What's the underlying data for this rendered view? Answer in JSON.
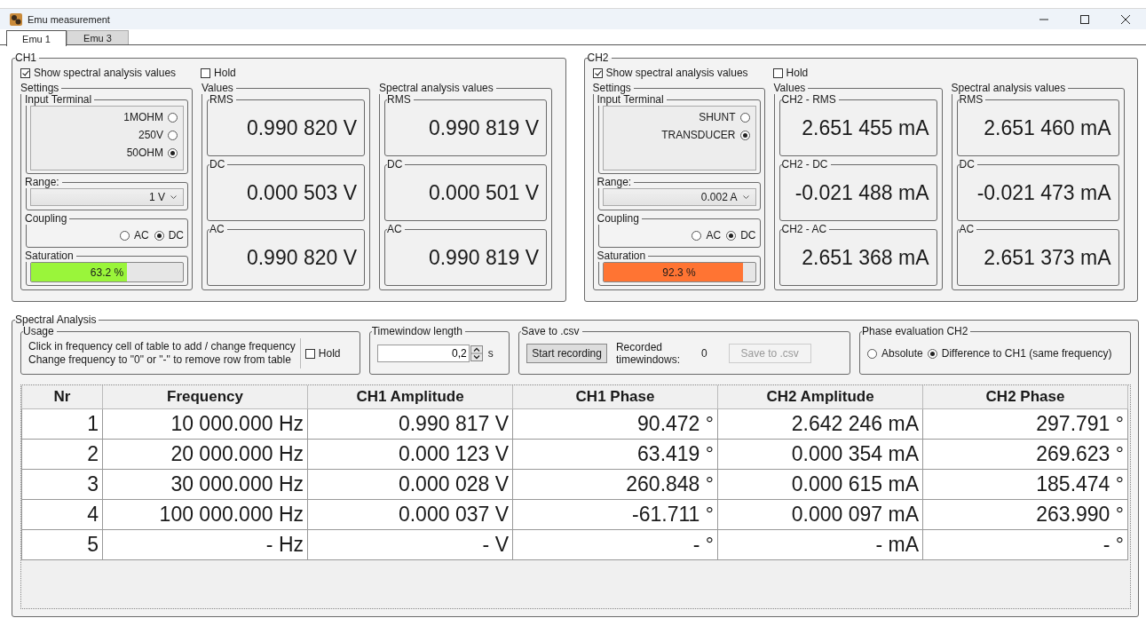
{
  "window": {
    "title": "Emu measurement"
  },
  "tabs": [
    {
      "label": "Emu 1",
      "selected": true
    },
    {
      "label": "Emu 3",
      "selected": false
    }
  ],
  "channels": [
    {
      "title": "CH1",
      "show_spectral": {
        "label": "Show spectral analysis values",
        "checked": true
      },
      "hold": {
        "label": "Hold",
        "checked": false
      },
      "settings": {
        "title": "Settings",
        "input_terminal": {
          "title": "Input Terminal",
          "options": [
            {
              "label": "1MOHM",
              "selected": false
            },
            {
              "label": "250V",
              "selected": false
            },
            {
              "label": "50OHM",
              "selected": true
            }
          ]
        },
        "range": {
          "title": "Range:",
          "value": "1 V"
        },
        "coupling": {
          "title": "Coupling",
          "options": [
            {
              "label": "AC",
              "selected": false
            },
            {
              "label": "DC",
              "selected": true
            }
          ]
        },
        "saturation": {
          "title": "Saturation",
          "level": 0.632,
          "reading": "63.2 %",
          "color": "#9af53a"
        }
      },
      "values": {
        "title": "Values",
        "items": [
          {
            "label": "RMS",
            "value": "0.990 820 V"
          },
          {
            "label": "DC",
            "value": "0.000 503 V"
          },
          {
            "label": "AC",
            "value": "0.990 820 V"
          }
        ]
      },
      "spectral": {
        "title": "Spectral analysis values",
        "items": [
          {
            "label": "RMS",
            "value": "0.990 819 V"
          },
          {
            "label": "DC",
            "value": "0.000 501 V"
          },
          {
            "label": "AC",
            "value": "0.990 819 V"
          }
        ]
      }
    },
    {
      "title": "CH2",
      "show_spectral": {
        "label": "Show spectral analysis values",
        "checked": true
      },
      "hold": {
        "label": "Hold",
        "checked": false
      },
      "settings": {
        "title": "Settings",
        "input_terminal": {
          "title": "Input Terminal",
          "options": [
            {
              "label": "SHUNT",
              "selected": false
            },
            {
              "label": "TRANSDUCER",
              "selected": true
            }
          ]
        },
        "range": {
          "title": "Range:",
          "value": "0.002 A"
        },
        "coupling": {
          "title": "Coupling",
          "options": [
            {
              "label": "AC",
              "selected": false
            },
            {
              "label": "DC",
              "selected": true
            }
          ]
        },
        "saturation": {
          "title": "Saturation",
          "level": 0.923,
          "reading": "92.3 %",
          "color": "#ff7433"
        }
      },
      "values": {
        "title": "Values",
        "items": [
          {
            "label": "CH2 - RMS",
            "value": "2.651 455 mA"
          },
          {
            "label": "CH2 - DC",
            "value": "-0.021 488 mA"
          },
          {
            "label": "CH2 - AC",
            "value": "2.651 368 mA"
          }
        ]
      },
      "spectral": {
        "title": "Spectral analysis values",
        "items": [
          {
            "label": "RMS",
            "value": "2.651 460 mA"
          },
          {
            "label": "DC",
            "value": "-0.021 473 mA"
          },
          {
            "label": "AC",
            "value": "2.651 373 mA"
          }
        ]
      }
    }
  ],
  "spectral_analysis": {
    "title": "Spectral Analysis",
    "usage": {
      "title": "Usage",
      "lines": [
        "Click in frequency cell of table to add / change frequency",
        "Change frequency to \"0\" or \"-\" to remove row from table"
      ],
      "hold": {
        "label": "Hold",
        "checked": false
      }
    },
    "timewindow": {
      "title": "Timewindow length",
      "value": "0,2",
      "unit": "s"
    },
    "save": {
      "title": "Save to .csv",
      "start_button": "Start recording",
      "recorded_label": "Recorded timewindows:",
      "recorded_count": "0",
      "save_button": {
        "label": "Save to .csv",
        "disabled": true
      }
    },
    "phase": {
      "title": "Phase evaluation CH2",
      "options": [
        {
          "label": "Absolute",
          "selected": false
        },
        {
          "label": "Difference to CH1 (same frequency)",
          "selected": true
        }
      ]
    },
    "table": {
      "columns": [
        "Nr",
        "Frequency",
        "CH1 Amplitude",
        "CH1 Phase",
        "CH2 Amplitude",
        "CH2 Phase"
      ],
      "rows": [
        [
          "1",
          "10 000.000 Hz",
          "0.990 817 V",
          "90.472 °",
          "2.642 246 mA",
          "297.791 °"
        ],
        [
          "2",
          "20 000.000 Hz",
          "0.000 123 V",
          "63.419 °",
          "0.000 354 mA",
          "269.623 °"
        ],
        [
          "3",
          "30 000.000 Hz",
          "0.000 028 V",
          "260.848 °",
          "0.000 615 mA",
          "185.474 °"
        ],
        [
          "4",
          "100 000.000 Hz",
          "0.000 037 V",
          "-61.711 °",
          "0.000 097 mA",
          "263.990 °"
        ],
        [
          "5",
          "- Hz",
          "- V",
          "- °",
          "- mA",
          "- °"
        ]
      ]
    }
  }
}
